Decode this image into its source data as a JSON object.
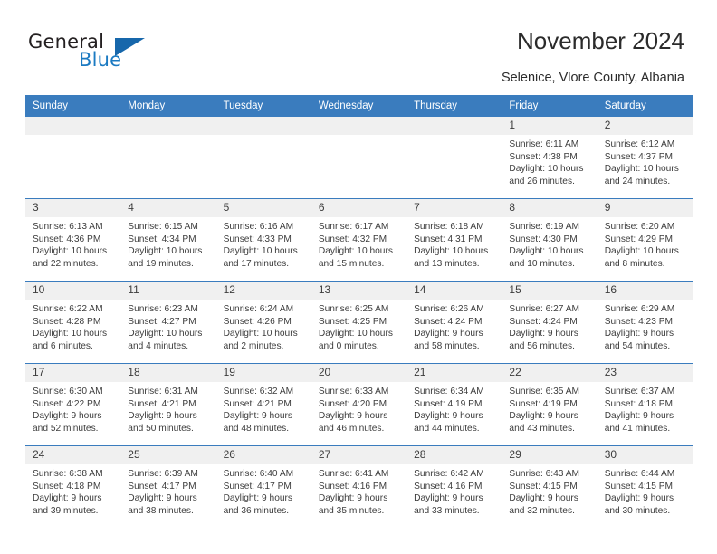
{
  "brand": {
    "name_top": "General",
    "name_bottom": "Blue",
    "triangle_icon": "blue-triangle-icon",
    "accent_color": "#1767ab"
  },
  "header": {
    "title": "November 2024",
    "subtitle": "Selenice, Vlore County, Albania"
  },
  "calendar": {
    "header_color": "#3a7cbe",
    "weekday_headers": [
      "Sunday",
      "Monday",
      "Tuesday",
      "Wednesday",
      "Thursday",
      "Friday",
      "Saturday"
    ],
    "weeks": [
      [
        {
          "day": "",
          "sunrise": "",
          "sunset": "",
          "daylight": ""
        },
        {
          "day": "",
          "sunrise": "",
          "sunset": "",
          "daylight": ""
        },
        {
          "day": "",
          "sunrise": "",
          "sunset": "",
          "daylight": ""
        },
        {
          "day": "",
          "sunrise": "",
          "sunset": "",
          "daylight": ""
        },
        {
          "day": "",
          "sunrise": "",
          "sunset": "",
          "daylight": ""
        },
        {
          "day": "1",
          "sunrise": "Sunrise: 6:11 AM",
          "sunset": "Sunset: 4:38 PM",
          "daylight": "Daylight: 10 hours and 26 minutes."
        },
        {
          "day": "2",
          "sunrise": "Sunrise: 6:12 AM",
          "sunset": "Sunset: 4:37 PM",
          "daylight": "Daylight: 10 hours and 24 minutes."
        }
      ],
      [
        {
          "day": "3",
          "sunrise": "Sunrise: 6:13 AM",
          "sunset": "Sunset: 4:36 PM",
          "daylight": "Daylight: 10 hours and 22 minutes."
        },
        {
          "day": "4",
          "sunrise": "Sunrise: 6:15 AM",
          "sunset": "Sunset: 4:34 PM",
          "daylight": "Daylight: 10 hours and 19 minutes."
        },
        {
          "day": "5",
          "sunrise": "Sunrise: 6:16 AM",
          "sunset": "Sunset: 4:33 PM",
          "daylight": "Daylight: 10 hours and 17 minutes."
        },
        {
          "day": "6",
          "sunrise": "Sunrise: 6:17 AM",
          "sunset": "Sunset: 4:32 PM",
          "daylight": "Daylight: 10 hours and 15 minutes."
        },
        {
          "day": "7",
          "sunrise": "Sunrise: 6:18 AM",
          "sunset": "Sunset: 4:31 PM",
          "daylight": "Daylight: 10 hours and 13 minutes."
        },
        {
          "day": "8",
          "sunrise": "Sunrise: 6:19 AM",
          "sunset": "Sunset: 4:30 PM",
          "daylight": "Daylight: 10 hours and 10 minutes."
        },
        {
          "day": "9",
          "sunrise": "Sunrise: 6:20 AM",
          "sunset": "Sunset: 4:29 PM",
          "daylight": "Daylight: 10 hours and 8 minutes."
        }
      ],
      [
        {
          "day": "10",
          "sunrise": "Sunrise: 6:22 AM",
          "sunset": "Sunset: 4:28 PM",
          "daylight": "Daylight: 10 hours and 6 minutes."
        },
        {
          "day": "11",
          "sunrise": "Sunrise: 6:23 AM",
          "sunset": "Sunset: 4:27 PM",
          "daylight": "Daylight: 10 hours and 4 minutes."
        },
        {
          "day": "12",
          "sunrise": "Sunrise: 6:24 AM",
          "sunset": "Sunset: 4:26 PM",
          "daylight": "Daylight: 10 hours and 2 minutes."
        },
        {
          "day": "13",
          "sunrise": "Sunrise: 6:25 AM",
          "sunset": "Sunset: 4:25 PM",
          "daylight": "Daylight: 10 hours and 0 minutes."
        },
        {
          "day": "14",
          "sunrise": "Sunrise: 6:26 AM",
          "sunset": "Sunset: 4:24 PM",
          "daylight": "Daylight: 9 hours and 58 minutes."
        },
        {
          "day": "15",
          "sunrise": "Sunrise: 6:27 AM",
          "sunset": "Sunset: 4:24 PM",
          "daylight": "Daylight: 9 hours and 56 minutes."
        },
        {
          "day": "16",
          "sunrise": "Sunrise: 6:29 AM",
          "sunset": "Sunset: 4:23 PM",
          "daylight": "Daylight: 9 hours and 54 minutes."
        }
      ],
      [
        {
          "day": "17",
          "sunrise": "Sunrise: 6:30 AM",
          "sunset": "Sunset: 4:22 PM",
          "daylight": "Daylight: 9 hours and 52 minutes."
        },
        {
          "day": "18",
          "sunrise": "Sunrise: 6:31 AM",
          "sunset": "Sunset: 4:21 PM",
          "daylight": "Daylight: 9 hours and 50 minutes."
        },
        {
          "day": "19",
          "sunrise": "Sunrise: 6:32 AM",
          "sunset": "Sunset: 4:21 PM",
          "daylight": "Daylight: 9 hours and 48 minutes."
        },
        {
          "day": "20",
          "sunrise": "Sunrise: 6:33 AM",
          "sunset": "Sunset: 4:20 PM",
          "daylight": "Daylight: 9 hours and 46 minutes."
        },
        {
          "day": "21",
          "sunrise": "Sunrise: 6:34 AM",
          "sunset": "Sunset: 4:19 PM",
          "daylight": "Daylight: 9 hours and 44 minutes."
        },
        {
          "day": "22",
          "sunrise": "Sunrise: 6:35 AM",
          "sunset": "Sunset: 4:19 PM",
          "daylight": "Daylight: 9 hours and 43 minutes."
        },
        {
          "day": "23",
          "sunrise": "Sunrise: 6:37 AM",
          "sunset": "Sunset: 4:18 PM",
          "daylight": "Daylight: 9 hours and 41 minutes."
        }
      ],
      [
        {
          "day": "24",
          "sunrise": "Sunrise: 6:38 AM",
          "sunset": "Sunset: 4:18 PM",
          "daylight": "Daylight: 9 hours and 39 minutes."
        },
        {
          "day": "25",
          "sunrise": "Sunrise: 6:39 AM",
          "sunset": "Sunset: 4:17 PM",
          "daylight": "Daylight: 9 hours and 38 minutes."
        },
        {
          "day": "26",
          "sunrise": "Sunrise: 6:40 AM",
          "sunset": "Sunset: 4:17 PM",
          "daylight": "Daylight: 9 hours and 36 minutes."
        },
        {
          "day": "27",
          "sunrise": "Sunrise: 6:41 AM",
          "sunset": "Sunset: 4:16 PM",
          "daylight": "Daylight: 9 hours and 35 minutes."
        },
        {
          "day": "28",
          "sunrise": "Sunrise: 6:42 AM",
          "sunset": "Sunset: 4:16 PM",
          "daylight": "Daylight: 9 hours and 33 minutes."
        },
        {
          "day": "29",
          "sunrise": "Sunrise: 6:43 AM",
          "sunset": "Sunset: 4:15 PM",
          "daylight": "Daylight: 9 hours and 32 minutes."
        },
        {
          "day": "30",
          "sunrise": "Sunrise: 6:44 AM",
          "sunset": "Sunset: 4:15 PM",
          "daylight": "Daylight: 9 hours and 30 minutes."
        }
      ]
    ]
  }
}
